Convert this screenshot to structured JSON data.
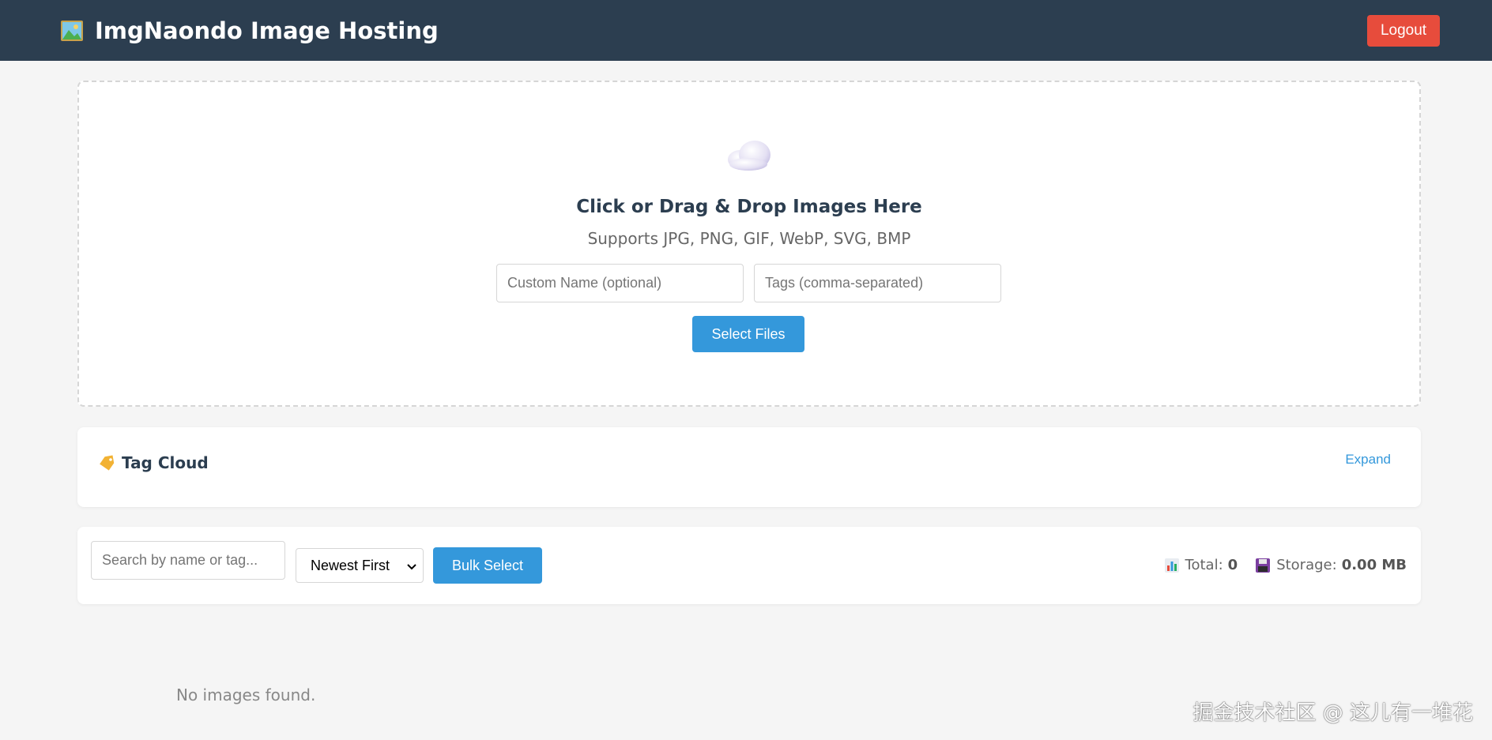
{
  "header": {
    "title": "ImgNaondo Image Hosting",
    "logo_icon": "picture-icon",
    "logout_label": "Logout",
    "bg_color": "#2c3e50",
    "logout_color": "#e74c3c"
  },
  "upload": {
    "icon": "cloud-icon",
    "title": "Click or Drag & Drop Images Here",
    "subtitle": "Supports JPG, PNG, GIF, WebP, SVG, BMP",
    "custom_name_placeholder": "Custom Name (optional)",
    "tags_placeholder": "Tags (comma-separated)",
    "select_files_label": "Select Files",
    "accent_color": "#3498db"
  },
  "tag_cloud": {
    "icon": "tag-icon",
    "title": "Tag Cloud",
    "expand_label": "Expand"
  },
  "toolbar": {
    "search_placeholder": "Search by name or tag...",
    "sort_selected": "Newest First",
    "bulk_select_label": "Bulk Select",
    "total_label": "Total:",
    "total_value": "0",
    "storage_label": "Storage:",
    "storage_value": "0.00 MB",
    "total_icon": "bar-chart-icon",
    "storage_icon": "floppy-disk-icon"
  },
  "gallery": {
    "empty_message": "No images found."
  },
  "watermark": "掘金技术社区 @ 这儿有一堆花"
}
